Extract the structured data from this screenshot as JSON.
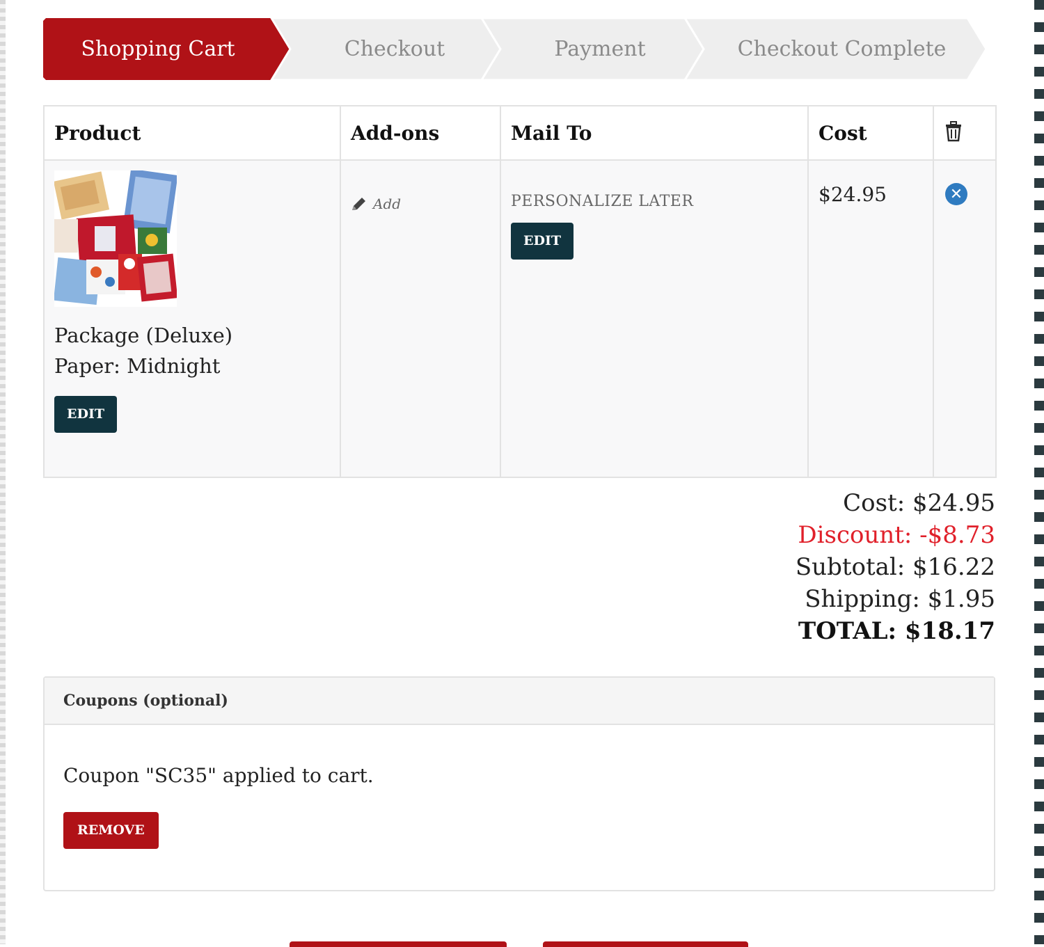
{
  "steps": [
    {
      "label": "Shopping Cart",
      "active": true
    },
    {
      "label": "Checkout",
      "active": false
    },
    {
      "label": "Payment",
      "active": false
    },
    {
      "label": "Checkout Complete",
      "active": false
    }
  ],
  "table": {
    "headers": {
      "product": "Product",
      "addons": "Add-ons",
      "mail_to": "Mail To",
      "cost": "Cost",
      "delete_icon": "trash-icon"
    },
    "row": {
      "product_name": "Package (Deluxe)",
      "paper": "Paper: Midnight",
      "product_edit": "EDIT",
      "addons_link": "Add",
      "mail_to_status": "PERSONALIZE LATER",
      "mail_edit": "EDIT",
      "cost": "$24.95",
      "remove_icon": "close-circle-icon"
    }
  },
  "totals": {
    "cost": "Cost: $24.95",
    "discount": "Discount: -$8.73",
    "subtotal": "Subtotal: $16.22",
    "shipping": "Shipping: $1.95",
    "total": "TOTAL: $18.17"
  },
  "coupons": {
    "title": "Coupons (optional)",
    "message": "Coupon \"SC35\" applied to cart.",
    "remove_label": "REMOVE"
  },
  "colors": {
    "brand_red": "#b01217",
    "dark_button": "#11343f",
    "discount_red": "#e0202a",
    "remove_blue": "#2f7bc0"
  }
}
